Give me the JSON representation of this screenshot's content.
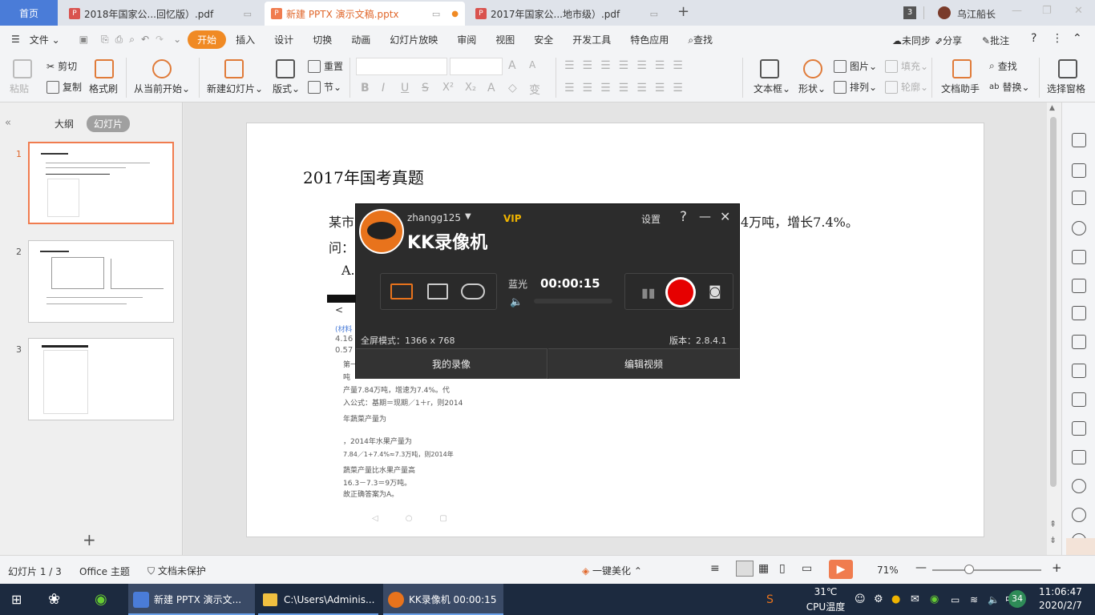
{
  "tabs": {
    "home": "首页",
    "tab1": "2018年国家公...回忆版）.pdf",
    "tab2": "新建 PPTX 演示文稿.pptx",
    "tab3": "2017年国家公...地市级）.pdf",
    "new_tab": "+",
    "badge": "3",
    "user": "乌江船长"
  },
  "menu": {
    "file": "文件",
    "items": [
      "开始",
      "插入",
      "设计",
      "切换",
      "动画",
      "幻灯片放映",
      "审阅",
      "视图",
      "安全",
      "开发工具",
      "特色应用"
    ],
    "search": "查找",
    "sync": "未同步",
    "share": "分享",
    "comment": "批注"
  },
  "ribbon": {
    "paste": "粘贴",
    "cut": "剪切",
    "copy": "复制",
    "format_painter": "格式刷",
    "from_current": "从当前开始",
    "new_slide": "新建幻灯片",
    "layout": "版式",
    "reset": "重置",
    "section": "节",
    "textbox": "文本框",
    "shape": "形状",
    "picture": "图片",
    "arrange": "排列",
    "fill": "填充",
    "outline": "轮廓",
    "doc_helper": "文档助手",
    "find": "查找",
    "replace": "替换",
    "select_pane": "选择窗格"
  },
  "left_panel": {
    "outline_tab": "大纲",
    "slides_tab": "幻灯片",
    "slide_numbers": [
      "1",
      "2",
      "3"
    ],
    "add": "+"
  },
  "slide": {
    "title": "2017年国考真题",
    "line1_start": "某市",
    "line1_end": "4万吨，增长7.4%。",
    "line2": "问：",
    "option_a": "A."
  },
  "phone": {
    "back": "<",
    "material": "(材料",
    "num1": "4.16",
    "num2": "0.57",
    "lines": [
      "第一",
      "吨",
      "产量7.84万吨，增速为7.4%。代",
      "入公式：基期＝现期／1＋r，则2014",
      "年蔬菜产量为",
      "，2014年水果产量为",
      "7.84／1+7.4%≈7.3万吨，则2014年",
      "蔬菜产量比水果产量高",
      "16.3－7.3＝9万吨。",
      "故正确答案为A。"
    ]
  },
  "kk": {
    "username": "zhangg125",
    "vip": "VIP",
    "settings": "设置",
    "help": "?",
    "title": "KK录像机",
    "quality": "蓝光",
    "timer": "00:00:15",
    "mode": "全屏模式：1366 x 768",
    "version": "版本：2.8.4.1",
    "my_recordings": "我的录像",
    "edit_video": "编辑视频"
  },
  "status": {
    "slide_counter": "幻灯片 1 / 3",
    "theme": "Office 主题",
    "protection": "文档未保护",
    "beautify": "一键美化",
    "zoom": "71%"
  },
  "taskbar": {
    "item1": "新建 PPTX 演示文...",
    "item2": "C:\\Users\\Adminis...",
    "item3": "KK录像机 00:00:15",
    "temp": "31℃",
    "temp_label": "CPU温度",
    "badge": "34",
    "time": "11:06:47",
    "date": "2020/2/7"
  },
  "colors": {
    "accent": "#f08a24",
    "record": "#e60000",
    "home_tab": "#4a7cd8",
    "taskbar": "#1c2a3f"
  }
}
